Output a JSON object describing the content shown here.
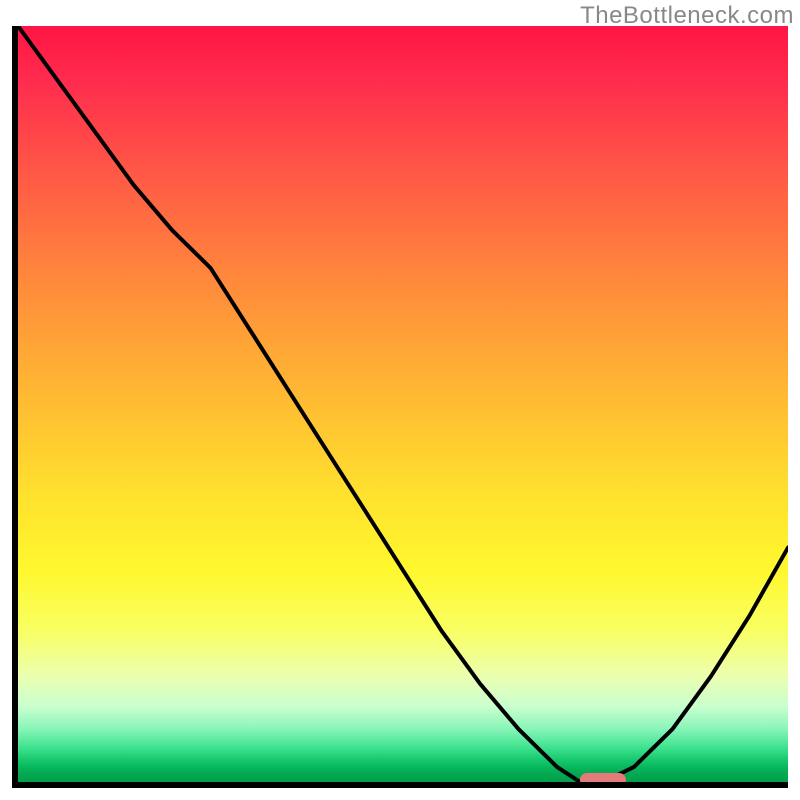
{
  "watermark": "TheBottleneck.com",
  "colors": {
    "gradient_top": "#ff1544",
    "gradient_mid": "#ffe12e",
    "gradient_bottom": "#02a04c",
    "curve": "#000000",
    "marker": "#e47a7a",
    "axis": "#000000"
  },
  "chart_data": {
    "type": "line",
    "title": "",
    "xlabel": "",
    "ylabel": "",
    "xlim": [
      0,
      100
    ],
    "ylim": [
      0,
      100
    ],
    "x": [
      0,
      5,
      10,
      15,
      20,
      25,
      30,
      35,
      40,
      45,
      50,
      55,
      60,
      65,
      70,
      73,
      76,
      80,
      85,
      90,
      95,
      100
    ],
    "values": [
      100,
      93,
      86,
      79,
      73,
      68,
      60,
      52,
      44,
      36,
      28,
      20,
      13,
      7,
      2,
      0,
      0,
      2,
      7,
      14,
      22,
      31
    ],
    "marker": {
      "x_start": 73,
      "x_end": 79,
      "y": 0
    },
    "note": "Values read off the image as percent of plot height (0 = bottom green, 100 = top red). x is percent of plot width."
  }
}
